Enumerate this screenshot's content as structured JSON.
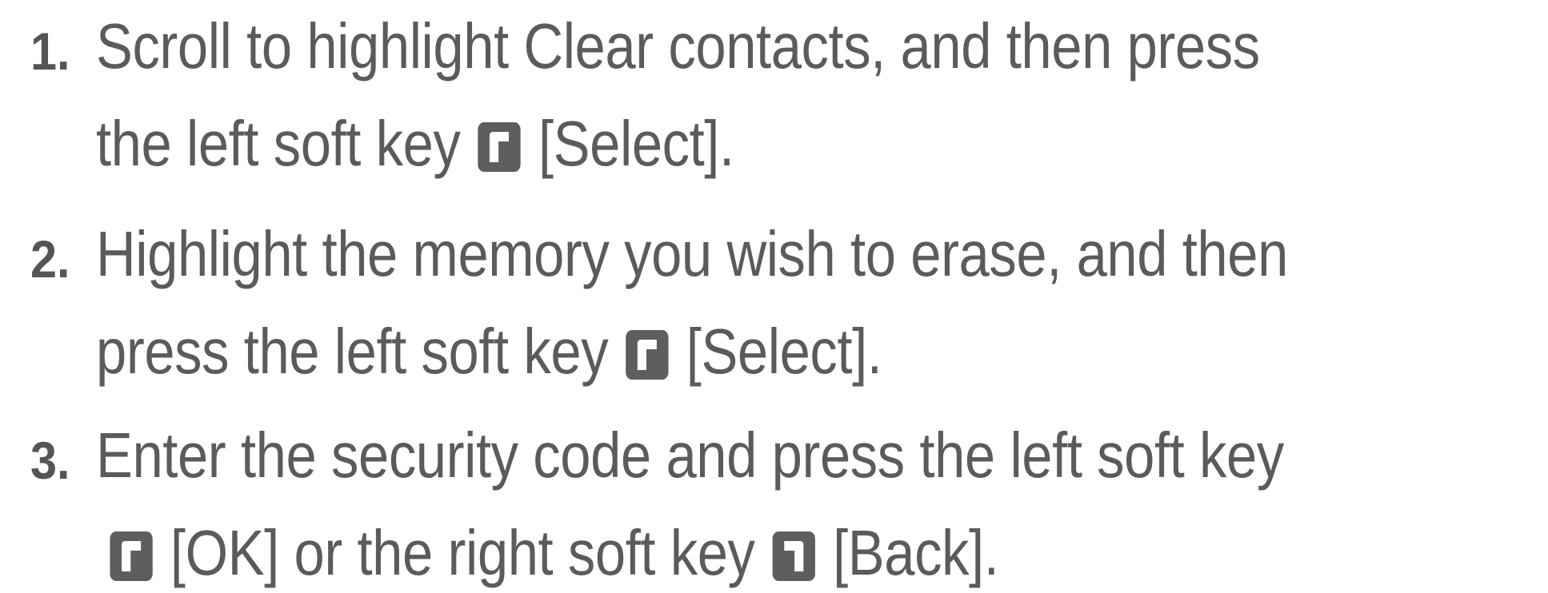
{
  "steps": [
    {
      "number": "1.",
      "line1": "Scroll to highlight Clear contacts, and then press",
      "line2_before": "the left soft key",
      "line2_key_icon": "left-soft-key-icon",
      "line2_after": " [Select]."
    },
    {
      "number": "2.",
      "line1": "Highlight the memory you wish to erase, and then",
      "line2_before": "press the left soft key",
      "line2_key_icon": "left-soft-key-icon",
      "line2_after": " [Select]."
    },
    {
      "number": "3.",
      "line1": "Enter the security code and press the left soft key",
      "line2_key1_icon": "left-soft-key-icon",
      "line2_middle": " [OK] or the right soft key",
      "line2_key2_icon": "right-soft-key-icon",
      "line2_after": " [Back]."
    }
  ],
  "colors": {
    "text": "#5b5b5b",
    "key_background": "#5e5e5e",
    "key_glyph": "#ffffff"
  }
}
